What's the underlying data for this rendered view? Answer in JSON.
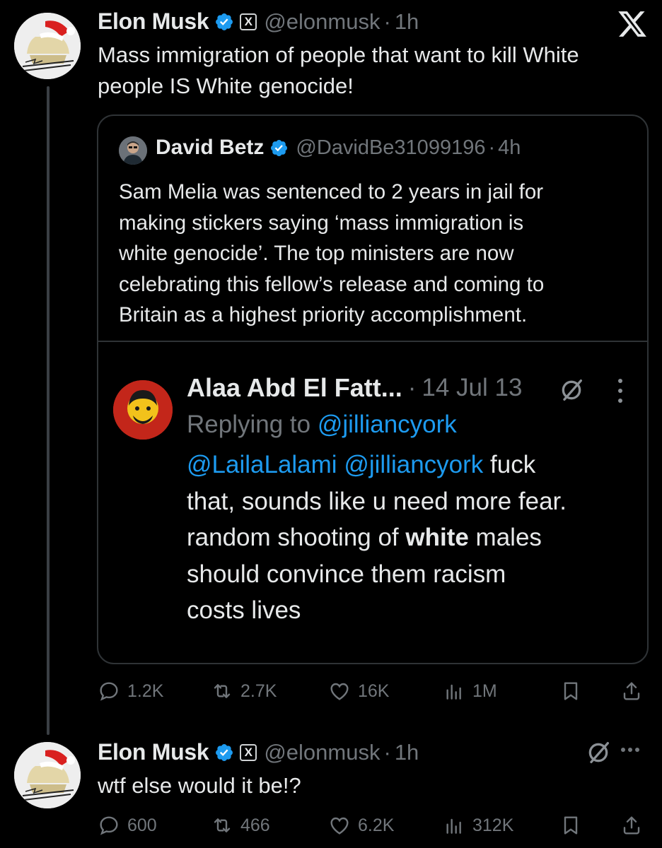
{
  "app": {
    "logo_icon": "x-logo-icon"
  },
  "main_tweet": {
    "author": {
      "name": "Elon Musk",
      "handle": "@elonmusk",
      "verified_color": "#1d9bf0",
      "affiliation_badge": "X"
    },
    "time": "1h",
    "sep": "·",
    "text_lines": [
      "Mass immigration of people that want to kill White",
      "people IS White genocide!"
    ],
    "quote": {
      "author": {
        "name": "David Betz",
        "handle": "@DavidBe31099196"
      },
      "time": "4h",
      "sep": "·",
      "text_lines": [
        "Sam Melia was sentenced to 2 years in jail for",
        "making stickers saying ‘mass immigration is",
        "white genocide’. The top ministers are now",
        "celebrating this fellow’s release and coming to",
        "Britain as a highest priority accomplishment."
      ],
      "screenshot": {
        "author": {
          "name": "Alaa Abd El Fatt..."
        },
        "sep": "·",
        "time": "14 Jul 13",
        "replying_label": "Replying to",
        "replying_to": "@jilliancyork",
        "mention_1": "@LailaLalami",
        "mention_2": "@jilliancyork",
        "text_after_mentions": " fuck",
        "line_2": "that, sounds like u need more fear.",
        "line_3_pre": "random shooting of ",
        "line_3_bold": "white",
        "line_3_post": " males",
        "line_4": "should convince them racism",
        "line_5": "costs lives"
      }
    },
    "stats": {
      "replies": "1.2K",
      "reposts": "2.7K",
      "likes": "16K",
      "views": "1M"
    }
  },
  "reply_tweet": {
    "author": {
      "name": "Elon Musk",
      "handle": "@elonmusk",
      "affiliation_badge": "X"
    },
    "time": "1h",
    "sep": "·",
    "text": "wtf else would it be!?",
    "stats": {
      "replies": "600",
      "reposts": "466",
      "likes": "6.2K",
      "views": "312K"
    }
  },
  "colors": {
    "background": "#000000",
    "text": "#e7e9ea",
    "muted": "#71767b",
    "link": "#1d9bf0",
    "border": "#2f3336"
  }
}
